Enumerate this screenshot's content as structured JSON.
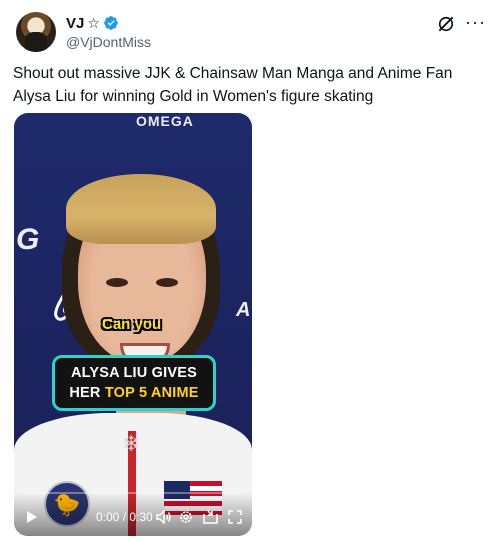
{
  "author": {
    "display_name": "VJ",
    "badge_symbol": "☆",
    "handle": "@VjDontMiss",
    "verified": true,
    "verified_color": "#1d9bf0"
  },
  "header": {
    "grok_icon": "grok-icon",
    "more_label": "···"
  },
  "tweet": {
    "text": "Shout out massive JJK & Chainsaw Man Manga and Anime Fan Alysa Liu for winning Gold in Women's figure skating"
  },
  "video": {
    "background_brands": [
      "OMEGA",
      "G",
      "A"
    ],
    "caption_small": "Can you",
    "caption_box_line1": "ALYSA LIU GIVES",
    "caption_box_line2_plain": "HER ",
    "caption_box_line2_highlight": "TOP 5 ANIME",
    "accent_border": "#2fd2c8",
    "highlight_color": "#ffd21f",
    "progress_fraction": 0,
    "controls": {
      "play_icon": "play-icon",
      "time": "0:00 / 0:30",
      "volume_icon": "volume-icon",
      "settings_icon": "settings-icon",
      "pip_icon": "pip-icon",
      "fullscreen_icon": "fullscreen-icon"
    }
  }
}
